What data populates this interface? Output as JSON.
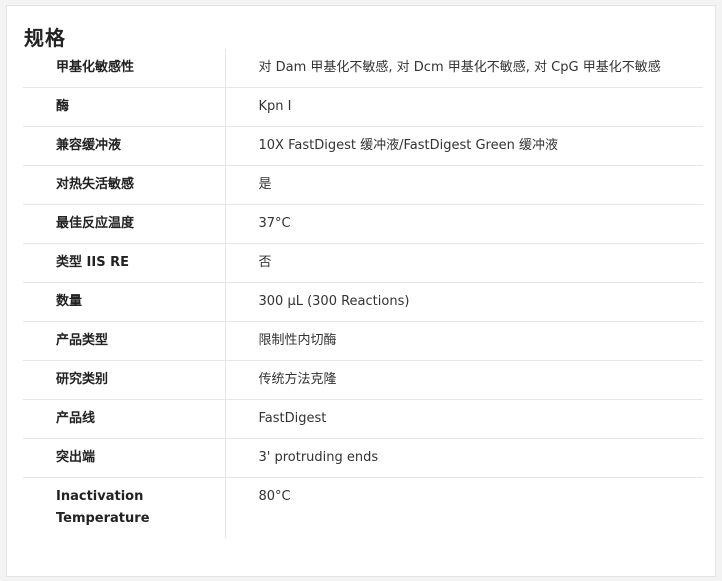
{
  "section": {
    "title": "规格"
  },
  "specs": [
    {
      "key": "甲基化敏感性",
      "value": "对 Dam 甲基化不敏感, 对 Dcm 甲基化不敏感, 对 CpG 甲基化不敏感"
    },
    {
      "key": "酶",
      "value": "Kpn I"
    },
    {
      "key": "兼容缓冲液",
      "value": "10X FastDigest 缓冲液/FastDigest Green 缓冲液"
    },
    {
      "key": "对热失活敏感",
      "value": "是"
    },
    {
      "key": "最佳反应温度",
      "value": "37°C"
    },
    {
      "key": "类型 IIS RE",
      "value": "否"
    },
    {
      "key": "数量",
      "value": "300 µL (300 Reactions)"
    },
    {
      "key": "产品类型",
      "value": "限制性内切酶"
    },
    {
      "key": "研究类别",
      "value": "传统方法克隆"
    },
    {
      "key": "产品线",
      "value": "FastDigest"
    },
    {
      "key": "突出端",
      "value": "3' protruding ends"
    },
    {
      "key": "Inactivation Temperature",
      "value": "80°C"
    }
  ]
}
